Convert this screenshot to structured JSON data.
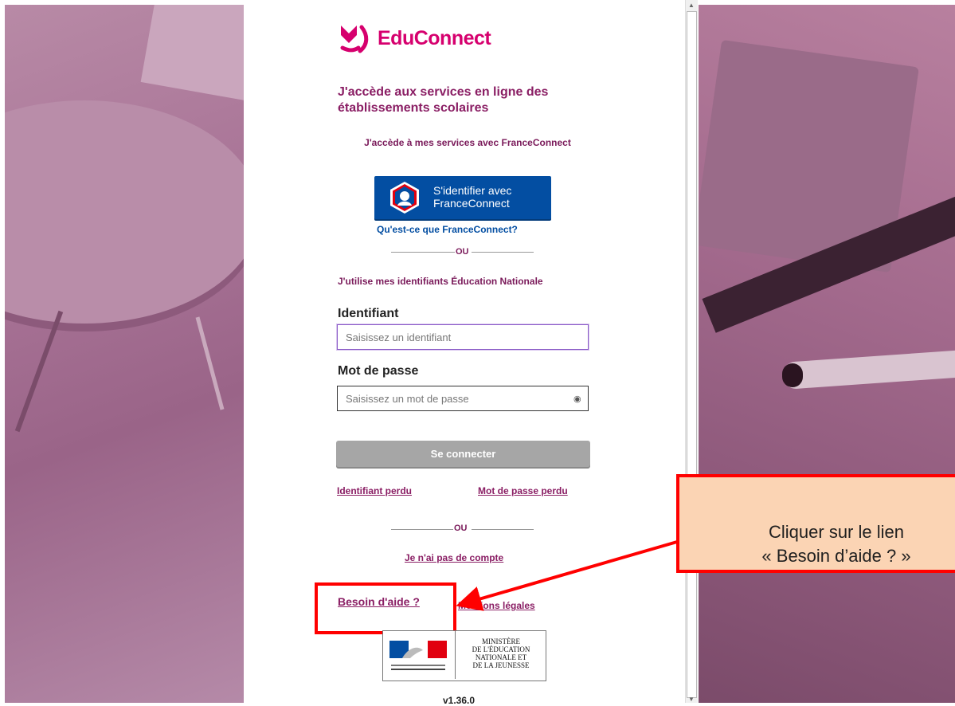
{
  "brand": {
    "name": "EduConnect",
    "color": "#d6006e"
  },
  "headline": "J'accède aux services en ligne des établissements scolaires",
  "franceconnect": {
    "intro": "J'accède à mes services avec FranceConnect",
    "button_line1": "S'identifier avec",
    "button_line2": "FranceConnect",
    "help_link": "Qu'est-ce que FranceConnect?"
  },
  "separator_label": "OU",
  "identifiers_intro": "J'utilise mes identifiants Éducation Nationale",
  "form": {
    "identifiant_label": "Identifiant",
    "identifiant_placeholder": "Saisissez un identifiant",
    "password_label": "Mot de passe",
    "password_placeholder": "Saisissez un mot de passe",
    "submit_label": "Se connecter"
  },
  "links": {
    "lost_id": "Identifiant perdu",
    "lost_password": "Mot de passe perdu",
    "no_account": "Je n'ai pas de compte",
    "help": "Besoin d'aide ?",
    "legal": "Mentions légales"
  },
  "ministry": {
    "line1": "MINISTÈRE",
    "line2": "DE L'ÉDUCATION",
    "line3": "NATIONALE ET",
    "line4": "DE LA JEUNESSE"
  },
  "version": "v1.36.0",
  "callout": {
    "line1": "Cliquer sur le lien",
    "line2": "« Besoin d’aide ? »"
  }
}
